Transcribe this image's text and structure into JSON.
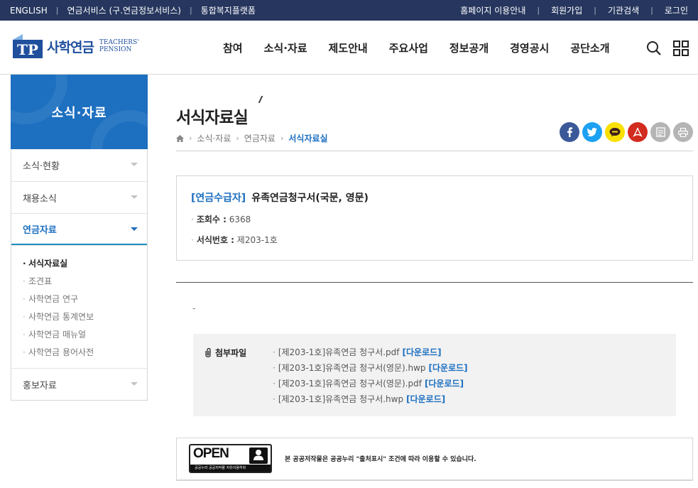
{
  "topbar": {
    "left_links": [
      "ENGLISH",
      "연금서비스 (구.연금정보서비스)",
      "통합복지플랫폼"
    ],
    "right_links": [
      "홈페이지 이용안내",
      "회원가입",
      "기관검색",
      "로그인"
    ],
    "separator": "|",
    "background_color": "#26365e"
  },
  "logo": {
    "mark": "TP",
    "name_ko": "사학연금",
    "name_en_line1": "TEACHERS'",
    "name_en_line2": "PENSION"
  },
  "nav": {
    "items": [
      "참여",
      "소식·자료",
      "제도안내",
      "주요사업",
      "정보공개",
      "경영공시",
      "공단소개"
    ],
    "search_icon": "search-icon",
    "menu_icon": "grid-menu-icon"
  },
  "sidebar": {
    "title": "소식·자료",
    "title_bg": "#1d6fc0",
    "items": [
      {
        "label": "소식·현황"
      },
      {
        "label": "채용소식"
      },
      {
        "label": "연금자료"
      },
      {
        "label": "홍보자료"
      }
    ],
    "sub_bullet": "·",
    "sub_items": [
      {
        "label": "서식자료실"
      },
      {
        "label": "조견표"
      },
      {
        "label": "사학연금 연구"
      },
      {
        "label": "사학연금 통계연보"
      },
      {
        "label": "사학연금 매뉴얼"
      },
      {
        "label": "사학연금 용어사전"
      }
    ]
  },
  "page": {
    "title": "서식자료실",
    "breadcrumb": [
      "소식·자료",
      "연금자료",
      "서식자료실"
    ],
    "breadcrumb_sep": "›",
    "share_icons": [
      "facebook-icon",
      "twitter-icon",
      "kakaotalk-icon",
      "pdf-icon",
      "save-icon",
      "print-icon"
    ]
  },
  "post": {
    "category": "[연금수급자]",
    "title": "유족연금청구서(국문, 영문)",
    "bullet": "·",
    "views_label": "조회수 :",
    "views": "6368",
    "form_no_label": "서식번호 :",
    "form_no": "제203-1호",
    "body_text": "-"
  },
  "attachments": {
    "label": "첨부파일",
    "bullet": "·",
    "download_label": "[다운로드]",
    "files": [
      "[제203-1호]유족연금 청구서.pdf",
      "[제203-1호]유족연금 청구서(영문).hwp",
      "[제203-1호]유족연금 청구서(영문).pdf",
      "[제203-1호]유족연금 청구서.hwp"
    ]
  },
  "license": {
    "kogl_text": "OPEN",
    "kogl_bar": "공공누리 공공저작물 자유이용허락",
    "text": "본 공공저작물은 공공누리 \"출처표시\" 조건에 따라 이용할 수 있습니다."
  },
  "colors": {
    "accent": "#1d6fc0",
    "facebook": "#3b5998",
    "twitter": "#1da1f2",
    "kakao": "#f9e000",
    "pdf": "#d22b1f",
    "gray_icon": "#b5b5b5"
  }
}
